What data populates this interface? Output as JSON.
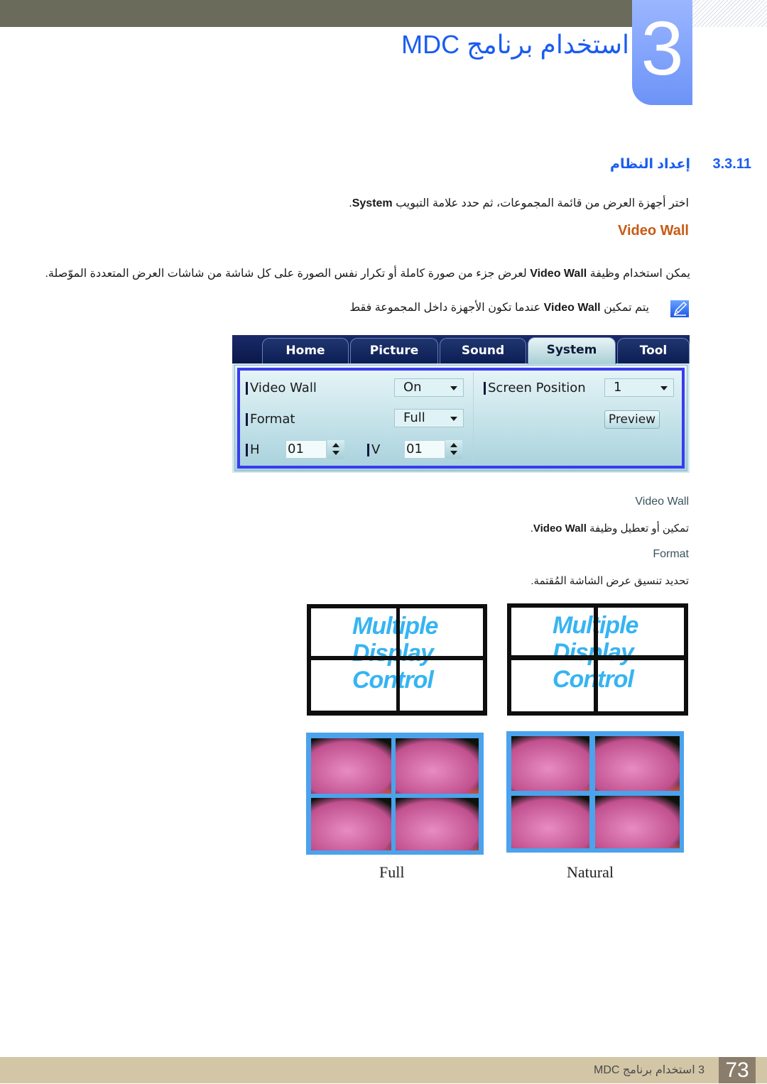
{
  "header": {
    "chapter_number": "3",
    "chapter_title": "استخدام برنامج MDC"
  },
  "section": {
    "number": "3.3.11",
    "title": "إعداد النظام",
    "intro_prefix": "اختر أجهزة العرض من قائمة المجموعات، ثم حدد علامة التبويب ",
    "intro_bold": "System",
    "intro_suffix": "."
  },
  "video_wall": {
    "heading": "Video Wall",
    "desc_prefix": "يمكن استخدام وظيفة ",
    "desc_bold": "Video Wall",
    "desc_suffix": " لعرض جزء من صورة كاملة أو تكرار نفس الصورة على كل شاشة من شاشات العرض المتعددة الموّصلة.",
    "note_prefix": "يتم تمكين ",
    "note_bold": "Video Wall",
    "note_suffix": " عندما تكون الأجهزة داخل المجموعة فقط",
    "note_icon": "note-pencil-icon"
  },
  "mdc_panel": {
    "tabs": [
      {
        "label": "Home",
        "active": false
      },
      {
        "label": "Picture",
        "active": false
      },
      {
        "label": "Sound",
        "active": false
      },
      {
        "label": "System",
        "active": true
      },
      {
        "label": "Tool",
        "active": false
      }
    ],
    "video_wall_label": "Video Wall",
    "video_wall_value": "On",
    "format_label": "Format",
    "format_value": "Full",
    "h_label": "H",
    "h_value": "01",
    "v_label": "V",
    "v_value": "01",
    "screen_position_label": "Screen Position",
    "screen_position_value": "1",
    "preview_label": "Preview"
  },
  "definitions": [
    {
      "term": "Video Wall",
      "desc_prefix": "تمكين أو تعطيل وظيفة ",
      "desc_bold": "Video Wall",
      "desc_suffix": "."
    },
    {
      "term": "Format",
      "desc": "تحديد تنسيق عرض الشاشة المُقتمة."
    }
  ],
  "illustrations": {
    "mdc_text_lines": [
      "Multiple",
      "Display",
      "Control"
    ],
    "captions": [
      "Full",
      "Natural"
    ]
  },
  "footer": {
    "text": "3 استخدام برنامج MDC",
    "page_number": "73"
  },
  "colors": {
    "accent_blue": "#1a5cf0",
    "subhead_orange": "#c85a14",
    "panel_frame": "#3a3af0",
    "footer_bar": "#d3c6a6"
  }
}
